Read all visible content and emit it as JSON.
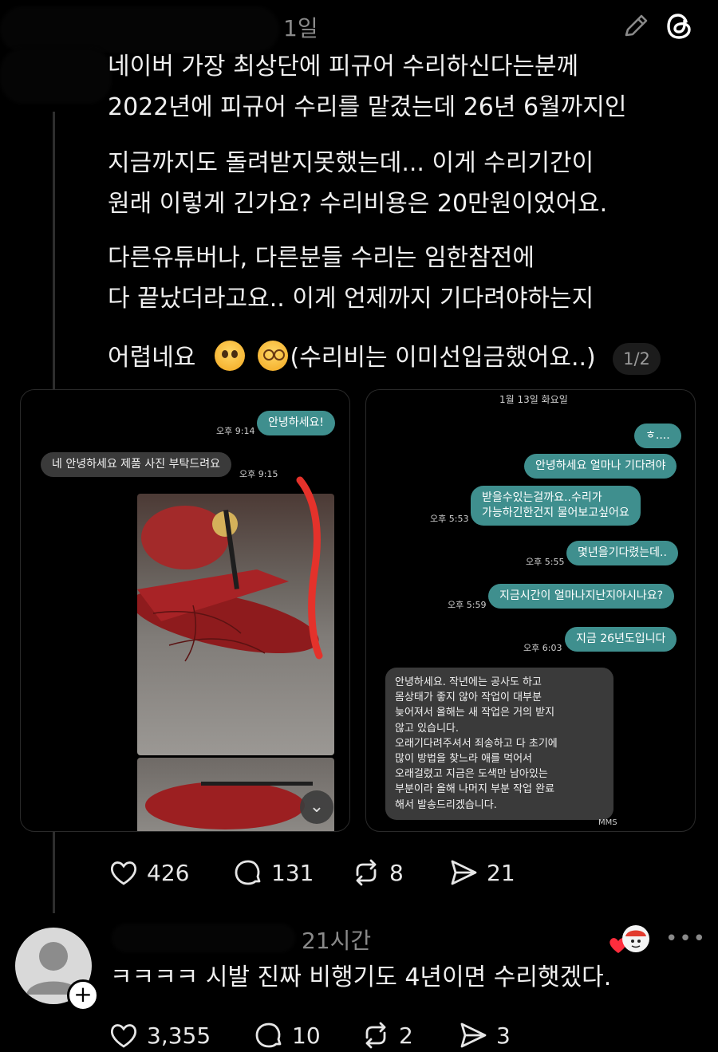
{
  "post": {
    "time_ago": "1일",
    "lines": [
      "네이버 가장 최상단에 피규어 수리하신다는분께",
      "2022년에 피규어 수리를 맡겼는데 26년 6월까지인",
      "지금까지도 돌려받지못했는데... 이게 수리기간이",
      "원래 이렇게 긴가요? 수리비용은 20만원이었어요.",
      "다른유튜버나, 다른분들 수리는 임한참전에",
      "다 끝났더라고요.. 이게 언제까지 기다려야하는지"
    ],
    "last_line_a": "어렵네요",
    "last_line_b": "(수리비는 이미선입금했어요..)",
    "page_indicator": "1/2",
    "actions": {
      "likes": "426",
      "comments": "131",
      "reposts": "8",
      "shares": "21"
    }
  },
  "shot_left": {
    "time1": "오후 9:14",
    "msg1": "안녕하세요!",
    "msg2": "네 안녕하세요 제품 사진 부탁드려요",
    "time2": "오후 9:15"
  },
  "shot_right": {
    "date": "1월 13일 화요일",
    "msg1": "ㅎ....",
    "msg2": "안녕하세요 얼마나 기다려야",
    "msg3_line1": "받을수있는걸까요..수리가",
    "msg3_line2": "가능하긴한건지 물어보고싶어요",
    "time3": "오후 5:53",
    "msg4": "몇년을기다렸는데..",
    "time4": "오후 5:55",
    "msg5": "지금시간이 얼마나지난지아시나요?",
    "time5": "오후 5:59",
    "msg6": "지금 26년도입니다",
    "time6": "오후 6:03",
    "reply": "안녕하세요. 작년에는 공사도 하고\n몸상태가 좋지 않아 작업이 대부분\n늦어져서 올해는 새 작업은 거의 받지\n않고 있습니다.\n오래기다려주셔서 죄송하고 다 초기에\n많이 방법을 찾느라 애를 먹어서\n오래걸렸고 지금은 도색만 남아있는\n부분이라 올해 나머지 부분 작업 완료\n해서 발송드리겠습니다.",
    "mms": "MMS"
  },
  "reply": {
    "time_ago": "21시간",
    "text": "ㅋㅋㅋㅋ 시발 진짜 비행기도 4년이면 수리햇겠다.",
    "actions": {
      "likes": "3,355",
      "comments": "10",
      "reposts": "2",
      "shares": "3"
    }
  }
}
